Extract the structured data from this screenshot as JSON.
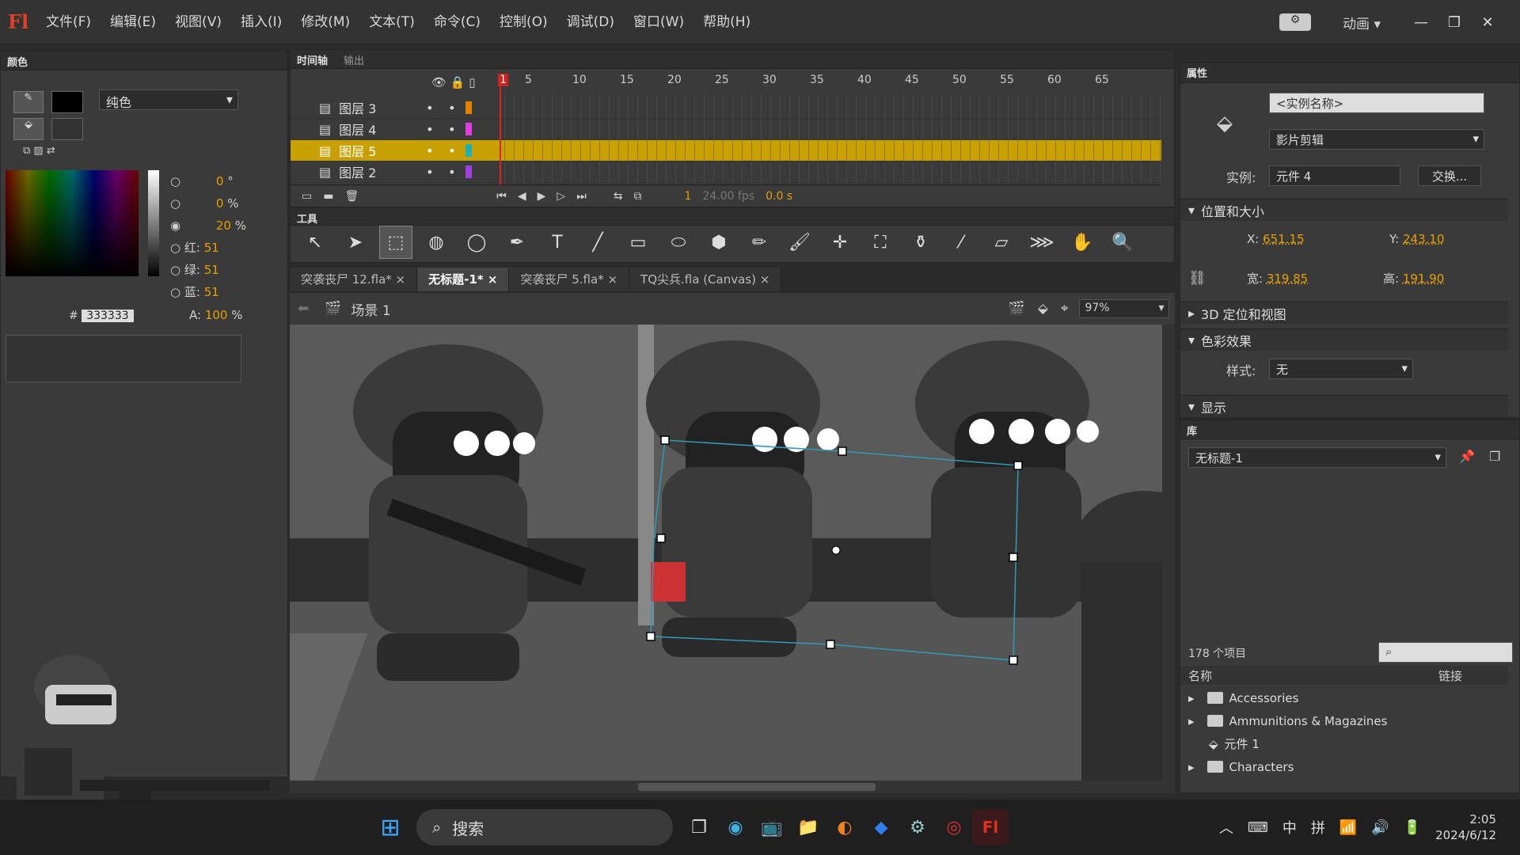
{
  "menubar": {
    "logo": "Fl",
    "items": [
      "文件(F)",
      "编辑(E)",
      "视图(V)",
      "插入(I)",
      "修改(M)",
      "文本(T)",
      "命令(C)",
      "控制(O)",
      "调试(D)",
      "窗口(W)",
      "帮助(H)"
    ],
    "workspace": "动画"
  },
  "color_panel": {
    "title": "颜色",
    "fill_type": "纯色",
    "h": "0",
    "h_unit": "°",
    "s": "0",
    "s_unit": "%",
    "b": "20",
    "b_unit": "%",
    "r_label": "红:",
    "r": "51",
    "g_label": "绿:",
    "g": "51",
    "b_label": "蓝:",
    "bl": "51",
    "hex_label": "#",
    "hex": "333333",
    "a_label": "A:",
    "alpha": "100",
    "alpha_unit": "%"
  },
  "timeline": {
    "tab1": "时间轴",
    "tab2": "输出",
    "ruler": [
      "1",
      "5",
      "10",
      "15",
      "20",
      "25",
      "30",
      "35",
      "40",
      "45",
      "50",
      "55",
      "60",
      "65"
    ],
    "layers": [
      {
        "name": "图层 3",
        "color": "#e08000"
      },
      {
        "name": "图层 4",
        "color": "#e040e0"
      },
      {
        "name": "图层 5",
        "color": "#20b0b0"
      },
      {
        "name": "图层 2",
        "color": "#a040e0"
      }
    ],
    "frame": "1",
    "fps": "24.00 fps",
    "time": "0.0 s"
  },
  "tools": {
    "title": "工具"
  },
  "doc_tabs": [
    "突袭丧尸 12.fla*",
    "无标题-1*",
    "突袭丧尸 5.fla*",
    "TQ尖兵.fla (Canvas)"
  ],
  "stage": {
    "scene": "场景 1",
    "zoom": "97%"
  },
  "properties": {
    "title": "属性",
    "instance_name_placeholder": "<实例名称>",
    "symbol_type": "影片剪辑",
    "instance_label": "实例:",
    "instance_value": "元件 4",
    "swap_button": "交换...",
    "pos_section": "位置和大小",
    "x_label": "X:",
    "x": "651.15",
    "y_label": "Y:",
    "y": "243.10",
    "w_label": "宽:",
    "w": "319.85",
    "h_label": "高:",
    "h": "191.90",
    "section_3d": "3D 定位和视图",
    "color_effect": "色彩效果",
    "style_label": "样式:",
    "style_value": "无",
    "display": "显示"
  },
  "library": {
    "title": "库",
    "doc": "无标题-1",
    "count": "178 个项目",
    "col_name": "名称",
    "col_link": "链接",
    "items": [
      {
        "name": "Accessories",
        "type": "folder"
      },
      {
        "name": "Ammunitions & Magazines",
        "type": "folder"
      },
      {
        "name": "元件 1",
        "type": "symbol"
      },
      {
        "name": "Characters",
        "type": "folder"
      }
    ]
  },
  "taskbar": {
    "search": "搜索",
    "time": "2:05",
    "date": "2024/6/12",
    "ime1": "中",
    "ime2": "拼"
  }
}
